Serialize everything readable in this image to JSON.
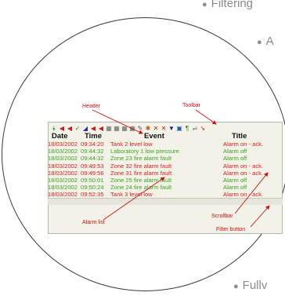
{
  "bullets": {
    "top": "Filtering",
    "upper_right": "A",
    "bottom": "Fullv"
  },
  "annotations": {
    "header": "Header",
    "toolbar": "Toolbar",
    "alarm_list": "Alarm list",
    "scrollbar": "Scrollbar",
    "filter_button": "Filter button"
  },
  "columns": {
    "date": "Date",
    "time": "Time",
    "event": "Event",
    "title": "Title"
  },
  "rows": [
    {
      "date": "18/03/2002",
      "time": "09:34:20",
      "event": "Tank 2 level low",
      "title": "Alarm on - ack.",
      "status": "alarm"
    },
    {
      "date": "18/03/2002",
      "time": "09:44:32",
      "event": "Laboratory 1 low pressure",
      "title": "Alarm off",
      "status": "off"
    },
    {
      "date": "18/03/2002",
      "time": "09:44:32",
      "event": "Zone 23 fire alarm fault",
      "title": "Alarm off",
      "status": "off"
    },
    {
      "date": "18/03/2002",
      "time": "09:49:53",
      "event": "Zone 32 fire alarm fault",
      "title": "Alarm on - ack.",
      "status": "alarm"
    },
    {
      "date": "18/03/2002",
      "time": "09:49:56",
      "event": "Zone 31 fire alarm fault",
      "title": "Alarm on - ack.",
      "status": "alarm"
    },
    {
      "date": "18/03/2002",
      "time": "09:50:01",
      "event": "Zone 25 fire alarm fault",
      "title": "Alarm off",
      "status": "off"
    },
    {
      "date": "18/03/2002",
      "time": "09:50:24",
      "event": "Zone 24 fire alarm fault",
      "title": "Alarm off",
      "status": "off"
    },
    {
      "date": "18/03/2002",
      "time": "09:52:35",
      "event": "Tank 3 level low",
      "title": "Alarm on - ack.",
      "status": "alarm"
    }
  ],
  "colors": {
    "alarm": "#e0201c",
    "off": "#3aa81e",
    "annotation": "#d01010"
  },
  "toolbar_icons": [
    "double-chevron-down-icon",
    "alarm-bell-icon",
    "alarm-bell-icon",
    "alarm-check-icon",
    "alarm-filter-icon",
    "alarm-bell-icon",
    "alarm-mute-icon",
    "grid-icon",
    "grid-icon",
    "grid-icon",
    "grid-icon",
    "wrench-icon",
    "tools-icon",
    "cross-icon",
    "cross-icon",
    "filter-icon",
    "image-icon",
    "text-icon",
    "link-icon",
    "arrow-icon"
  ]
}
